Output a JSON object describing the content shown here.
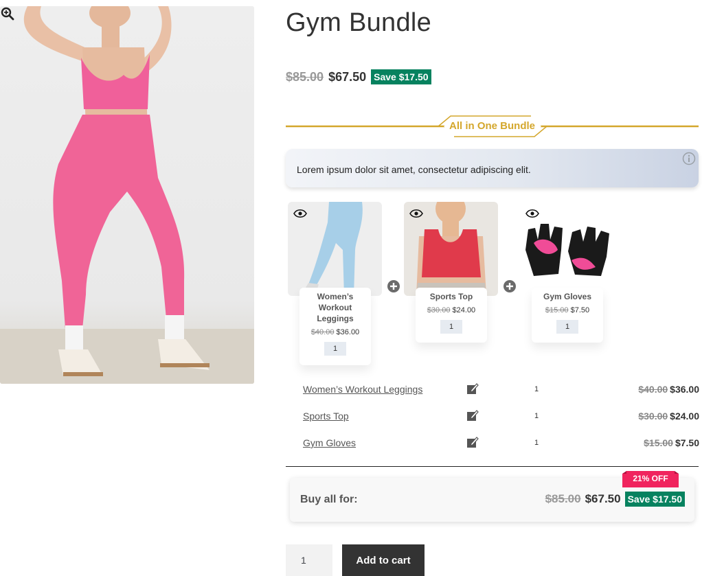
{
  "product": {
    "title": "Gym Bundle",
    "old_price": "$85.00",
    "new_price": "$67.50",
    "save_label": "Save $17.50"
  },
  "bundle": {
    "heading": "All in One Bundle",
    "info_text": "Lorem ipsum dolor sit amet, consectetur adipiscing elit.",
    "accent_color": "#d4a72c",
    "save_color": "#07825f",
    "items": [
      {
        "name": "Women’s Workout Leggings",
        "old_price": "$40.00",
        "new_price": "$36.00",
        "qty": "1"
      },
      {
        "name": "Sports Top",
        "old_price": "$30.00",
        "new_price": "$24.00",
        "qty": "1"
      },
      {
        "name": "Gym Gloves",
        "old_price": "$15.00",
        "new_price": "$7.50",
        "qty": "1"
      }
    ]
  },
  "summary": {
    "label": "Buy all for:",
    "old_price": "$85.00",
    "new_price": "$67.50",
    "save_label": "Save $17.50",
    "discount_badge": "21% OFF",
    "badge_color": "#f0245e"
  },
  "cart": {
    "quantity": "1",
    "button_label": "Add to cart"
  },
  "icons": [
    "zoom-icon",
    "info-icon",
    "eye-icon",
    "plus-icon",
    "edit-icon"
  ]
}
